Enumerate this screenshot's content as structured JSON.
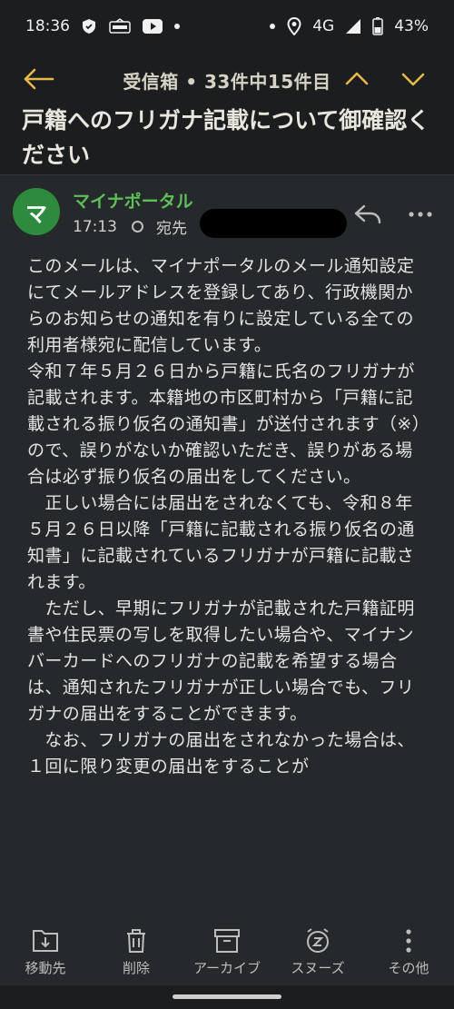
{
  "status": {
    "time": "18:36",
    "network": "4G",
    "battery": "43%"
  },
  "header": {
    "title": "受信箱 • 33件中15件目"
  },
  "email": {
    "subject": "戸籍へのフリガナ記載について御確認ください",
    "sender": "マイナポータル",
    "avatar_letter": "マ",
    "time": "17:13",
    "to_label": "宛先",
    "body": "このメールは、マイナポータルのメール通知設定にてメールアドレスを登録してあり、行政機関からのお知らせの通知を有りに設定している全ての利用者様宛に配信しています。\n令和７年５月２６日から戸籍に氏名のフリガナが記載されます。本籍地の市区町村から「戸籍に記載される振り仮名の通知書」が送付されます（※）ので、誤りがないか確認いただき、誤りがある場合は必ず振り仮名の届出をしてください。\n　正しい場合には届出をされなくても、令和８年５月２６日以降「戸籍に記載される振り仮名の通知書」に記載されているフリガナが戸籍に記載されます。\n　ただし、早期にフリガナが記載された戸籍証明書や住民票の写しを取得したい場合や、マイナンバーカードへのフリガナの記載を希望する場合は、通知されたフリガナが正しい場合でも、フリガナの届出をすることができます。\n　なお、フリガナの届出をされなかった場合は、１回に限り変更の届出をすることが"
  },
  "bottom_bar": {
    "move": "移動先",
    "delete": "削除",
    "archive": "アーカイブ",
    "snooze": "スヌーズ",
    "more": "その他"
  },
  "colors": {
    "background": "#1b1d1f",
    "card": "#25292b",
    "accent_yellow": "#e8b84a",
    "sender_green": "#5fbf5a",
    "avatar_green": "#2e8b3e"
  }
}
